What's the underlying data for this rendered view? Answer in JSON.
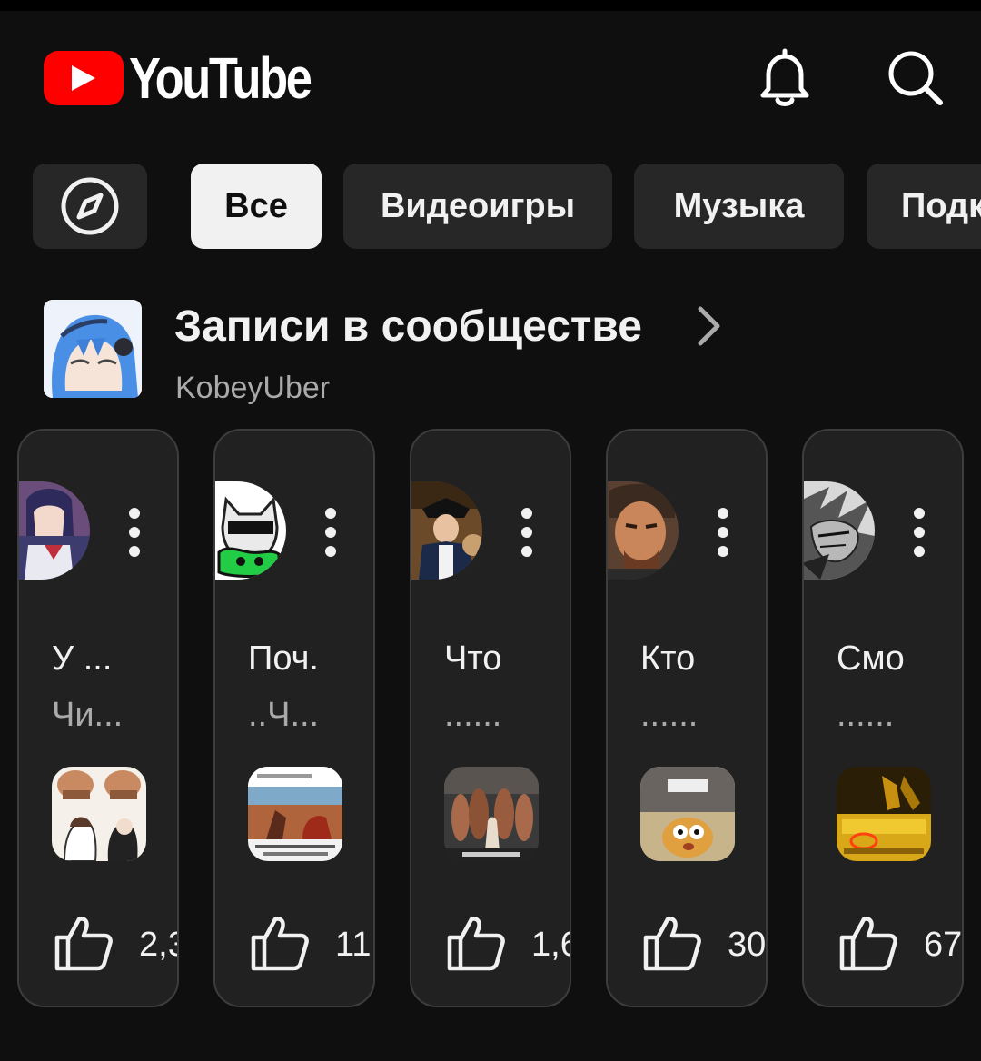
{
  "header": {
    "logo_text": "YouTube",
    "icons": [
      "notifications-bell-icon",
      "search-icon"
    ]
  },
  "chips": {
    "explore_icon": "compass-icon",
    "items": [
      "Все",
      "Видеоигры",
      "Музыка",
      "Подк"
    ],
    "active_index": 0
  },
  "community": {
    "title": "Записи в сообществе",
    "channel": "KobeyUber"
  },
  "posts": [
    {
      "title": "У ...",
      "sub": "Чи...",
      "likes": "2,3"
    },
    {
      "title": "Поч.",
      "sub": "..Ч...",
      "likes": "11"
    },
    {
      "title": "Что",
      "sub": "......",
      "likes": "1,6"
    },
    {
      "title": "Кто",
      "sub": "......",
      "likes": "30"
    },
    {
      "title": "Смо",
      "sub": "......",
      "likes": "67"
    }
  ],
  "colors": {
    "background": "#0f0f0f",
    "chip": "#272727",
    "chip_active": "#f1f1f1",
    "card": "#212121",
    "brand_red": "#ff0000",
    "secondary_text": "#aaaaaa"
  }
}
